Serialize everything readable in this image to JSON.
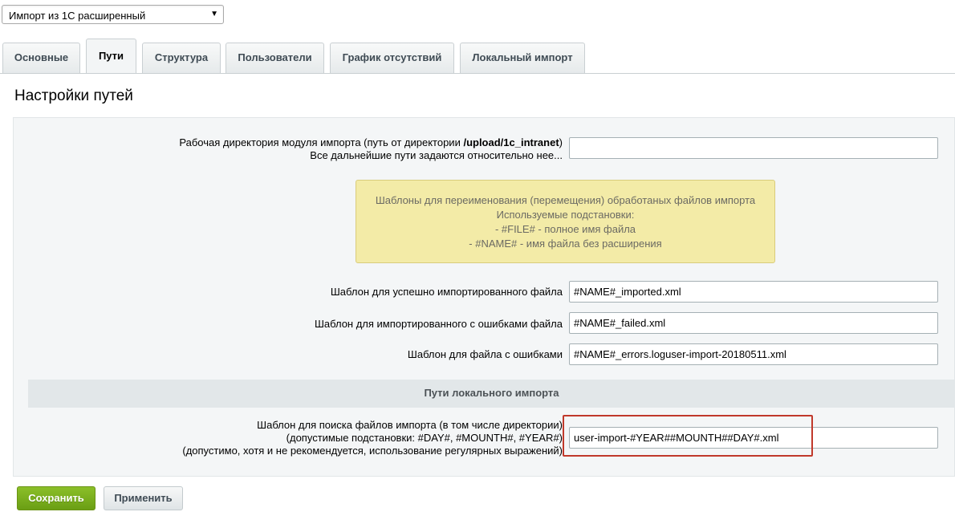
{
  "top_select": {
    "value": "Импорт из 1С расширенный",
    "arrow": "▼"
  },
  "tabs": [
    {
      "label": "Основные"
    },
    {
      "label": "Пути"
    },
    {
      "label": "Структура"
    },
    {
      "label": "Пользователи"
    },
    {
      "label": "График отсутствий"
    },
    {
      "label": "Локальный импорт"
    }
  ],
  "active_tab": "Пути",
  "page_title": "Настройки путей",
  "work_dir": {
    "label_line1": "Рабочая директория модуля импорта (путь от директории ",
    "label_path": "/upload/1c_intranet",
    "label_line1_end": ")",
    "label_line2": "Все дальнейшие пути задаются относительно нее...",
    "value": ""
  },
  "note": {
    "lines": [
      "Шаблоны для переименования (перемещения) обработаных файлов импорта",
      "Используемые подстановки:",
      "- #FILE# - полное имя файла",
      "- #NAME# - имя файла без расширения"
    ]
  },
  "fields": {
    "success": {
      "label": "Шаблон для успешно импортированного файла",
      "value": "#NAME#_imported.xml"
    },
    "failed": {
      "label": "Шаблон для импортированного с ошибками файла",
      "value": "#NAME#_failed.xml"
    },
    "errors": {
      "label": "Шаблон для файла с ошибками",
      "value": "#NAME#_errors.loguser-import-20180511.xml"
    }
  },
  "local_section": {
    "title": "Пути локального импорта"
  },
  "search_template": {
    "label_line1": "Шаблон для поиска файлов импорта (в том числе директории)",
    "label_line2": "(допустимые подстановки: #DAY#, #MOUNTH#, #YEAR#)",
    "label_line3": "(допустимо, хотя и не рекомендуется, использование регулярных выражений)",
    "value": "user-import-#YEAR##MOUNTH##DAY#.xml"
  },
  "buttons": {
    "save": "Сохранить",
    "apply": "Применить"
  },
  "colors": {
    "highlight": "#c0392b",
    "save_button": "#78ab1c",
    "note_bg": "#f3eba7"
  }
}
